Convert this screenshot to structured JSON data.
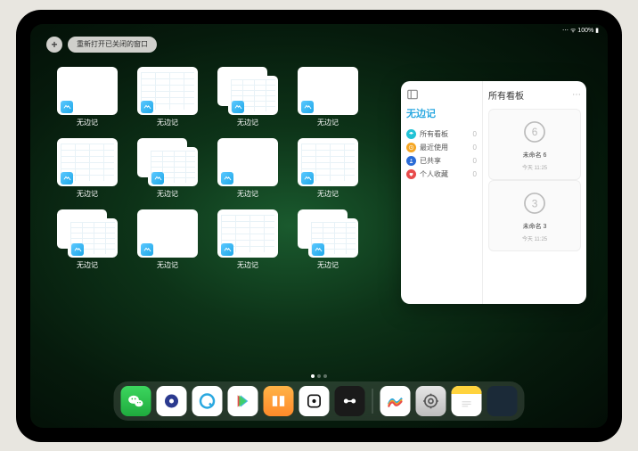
{
  "statusbar": {
    "time": "",
    "right": "⋯ ᯤ 100% ▮"
  },
  "controls": {
    "plus_label": "+",
    "reopen_label": "重新打开已关闭的窗口"
  },
  "thumbnail_app_label": "无边记",
  "thumbnails": [
    {
      "variant": "blank"
    },
    {
      "variant": "cal"
    },
    {
      "variant": "multi"
    },
    {
      "variant": "blank"
    },
    {
      "variant": "cal"
    },
    {
      "variant": "multi"
    },
    {
      "variant": "blank"
    },
    {
      "variant": "cal"
    },
    {
      "variant": "multi"
    },
    {
      "variant": "blank"
    },
    {
      "variant": "cal"
    },
    {
      "variant": "multi"
    }
  ],
  "popover": {
    "left_title": "无边记",
    "items": [
      {
        "icon": "layers",
        "color": "c-cyan",
        "label": "所有看板",
        "count": "0"
      },
      {
        "icon": "clock",
        "color": "c-orange",
        "label": "最近使用",
        "count": "0"
      },
      {
        "icon": "share",
        "color": "c-blue",
        "label": "已共享",
        "count": "0"
      },
      {
        "icon": "heart",
        "color": "c-red",
        "label": "个人收藏",
        "count": "0"
      }
    ],
    "right_title": "所有看板",
    "more": "⋯",
    "boards": [
      {
        "sketch": "6",
        "name": "未命名 6",
        "sub": "今天 11:25"
      },
      {
        "sketch": "3",
        "name": "未命名 3",
        "sub": "今天 11:25"
      }
    ]
  },
  "dock": {
    "apps": [
      {
        "name": "wechat-icon",
        "bg": "bg-wechat"
      },
      {
        "name": "quark-icon",
        "bg": "bg-white"
      },
      {
        "name": "browser-q-icon",
        "bg": "bg-white"
      },
      {
        "name": "play-icon",
        "bg": "bg-white"
      },
      {
        "name": "books-icon",
        "bg": "bg-orange-grad"
      },
      {
        "name": "dice-icon",
        "bg": "bg-white"
      },
      {
        "name": "dumbbell-icon",
        "bg": "bg-black"
      }
    ],
    "recent": [
      {
        "name": "freeform-icon",
        "bg": "bg-white"
      },
      {
        "name": "settings-icon",
        "bg": "bg-grey"
      },
      {
        "name": "notes-icon",
        "bg": "bg-notes"
      },
      {
        "name": "app-library-icon",
        "bg": "bg-quad"
      }
    ]
  }
}
